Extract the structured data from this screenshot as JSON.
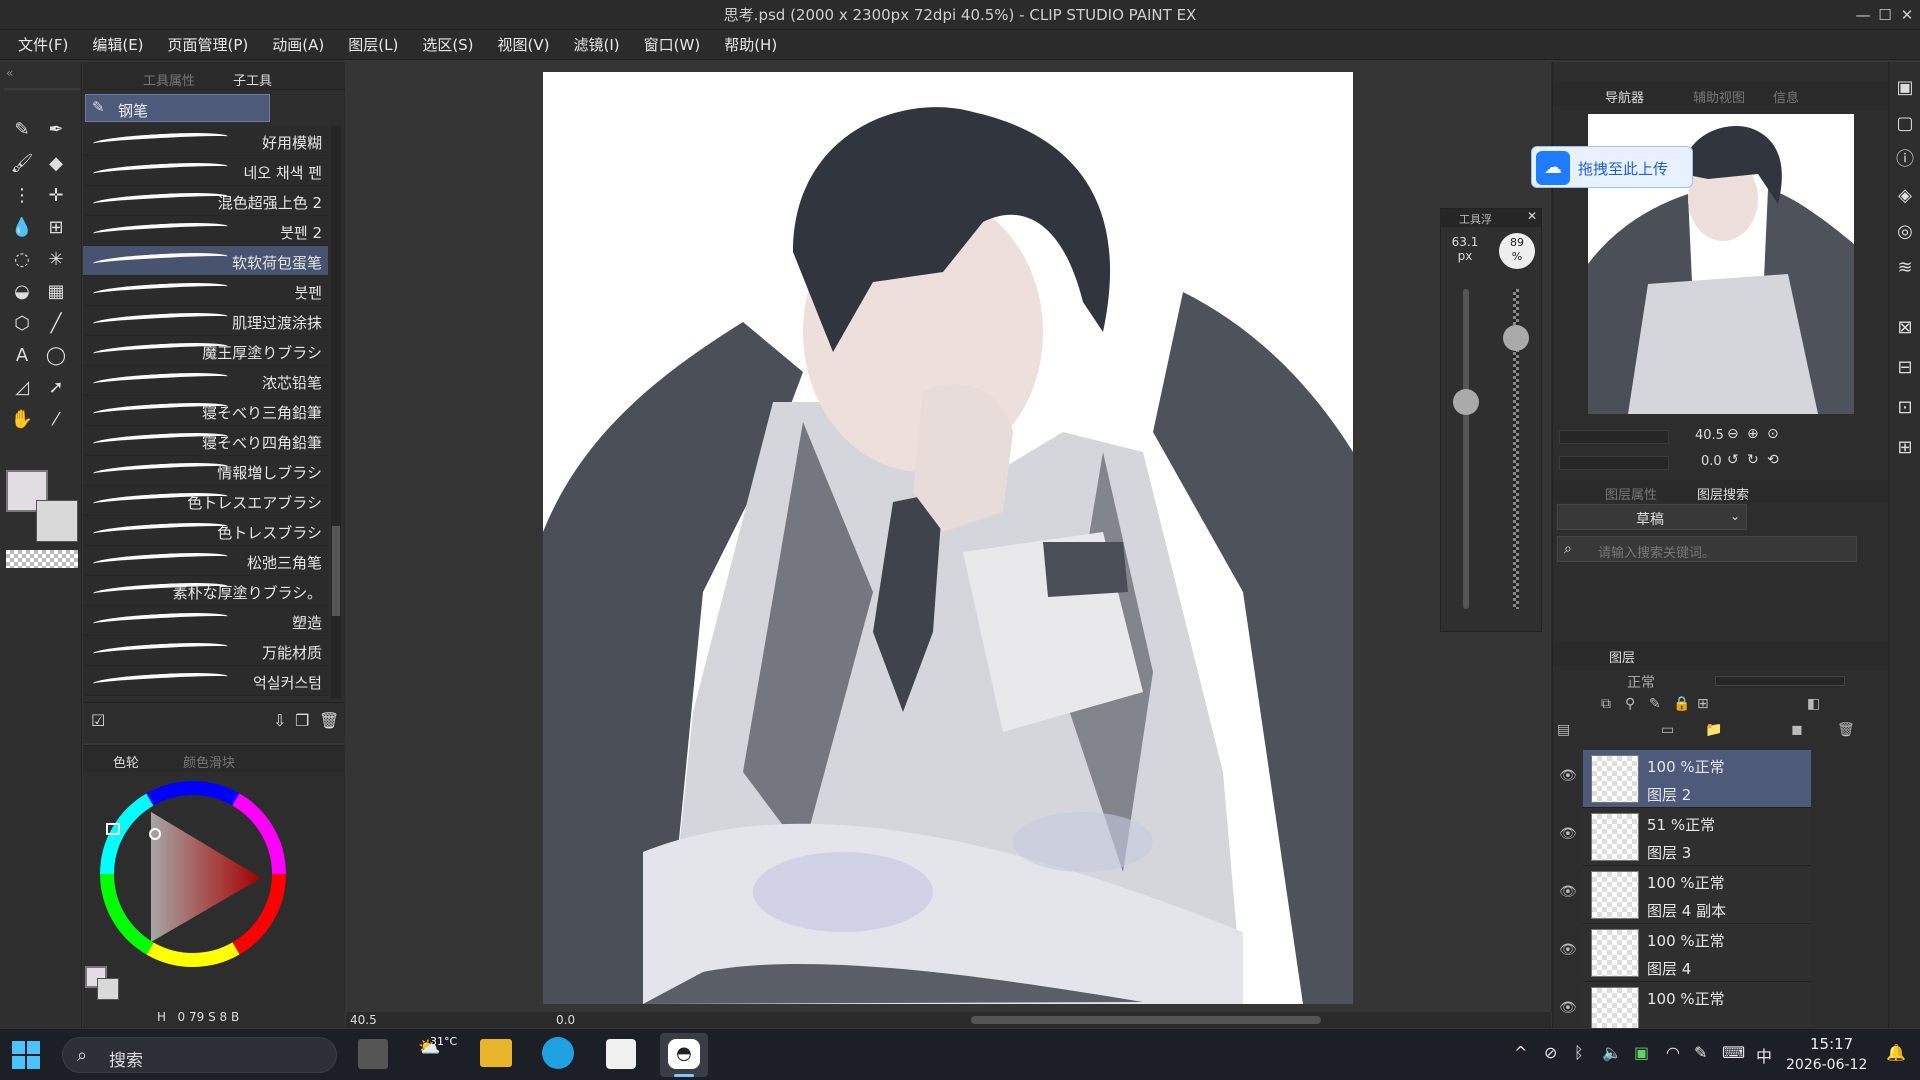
{
  "window": {
    "title": "思考.psd (2000 x 2300px 72dpi 40.5%)  - CLIP STUDIO PAINT EX",
    "min": "—",
    "max": "☐",
    "close": "✕"
  },
  "menu": [
    "文件(F)",
    "编辑(E)",
    "页面管理(P)",
    "动画(A)",
    "图层(L)",
    "选区(S)",
    "视图(V)",
    "滤镜(I)",
    "窗口(W)",
    "帮助(H)"
  ],
  "tool_panel": {
    "tab_tool_property": "工具属性",
    "tab_subtool": "子工具",
    "selected_subtool": "钢笔"
  },
  "brushes": [
    "好用模糊",
    "네오 채색 펜",
    "混色超强上色 2",
    "붓펜 2",
    "软软荷包蛋笔",
    "붓펜",
    "肌理过渡涂抹",
    "魔王厚塗りブラシ",
    "浓芯铅笔",
    "寝そべり三角鉛筆",
    "寝そべり四角鉛筆",
    "情報増しブラシ",
    "色トレスエアブラシ",
    "色トレスブラシ",
    "松弛三角笔",
    "素朴な厚塗りブラシ。",
    "塑造",
    "万能材质",
    "억실커스텀"
  ],
  "selected_brush_index": 4,
  "color_panel": {
    "tab_wheel": "色轮",
    "tab_mix": "颜色滑块",
    "h_label": "H",
    "h": "0",
    "s_label": "S",
    "s": "79",
    "v_label": "B",
    "v": "8",
    "accent": "#c94a4a"
  },
  "float_brush": {
    "title": "工具浮",
    "size": "63.1",
    "size_unit": "px",
    "opacity": "89",
    "opacity_unit": "%"
  },
  "canvas_status": {
    "zoom": "40.5",
    "angle": "0.0"
  },
  "navigator": {
    "tab_nav": "导航器",
    "tab_sub": "辅助视图",
    "tab_info": "信息",
    "zoom": "40.5",
    "angle": "0.0"
  },
  "upload_badge": "拖拽至此上传",
  "layer_search": {
    "tab_prop": "图层属性",
    "tab_search": "图层搜索",
    "draft": "草稿",
    "placeholder": "请输入搜索关键词。"
  },
  "layers_panel": {
    "title": "图层",
    "blend": "正常"
  },
  "layers": [
    {
      "opacity": "100",
      "mode": "%正常",
      "name": "图层 2",
      "selected": true
    },
    {
      "opacity": "51",
      "mode": "%正常",
      "name": "图层 3",
      "selected": false
    },
    {
      "opacity": "100",
      "mode": "%正常",
      "name": "图层 4 副本",
      "selected": false
    },
    {
      "opacity": "100",
      "mode": "%正常",
      "name": "图层 4",
      "selected": false
    },
    {
      "opacity": "100",
      "mode": "%正常",
      "name": "",
      "selected": false
    }
  ],
  "taskbar": {
    "search": "搜索",
    "weather": "31°C",
    "ime": "中",
    "time": "15:17",
    "date": "2026-06-12"
  }
}
